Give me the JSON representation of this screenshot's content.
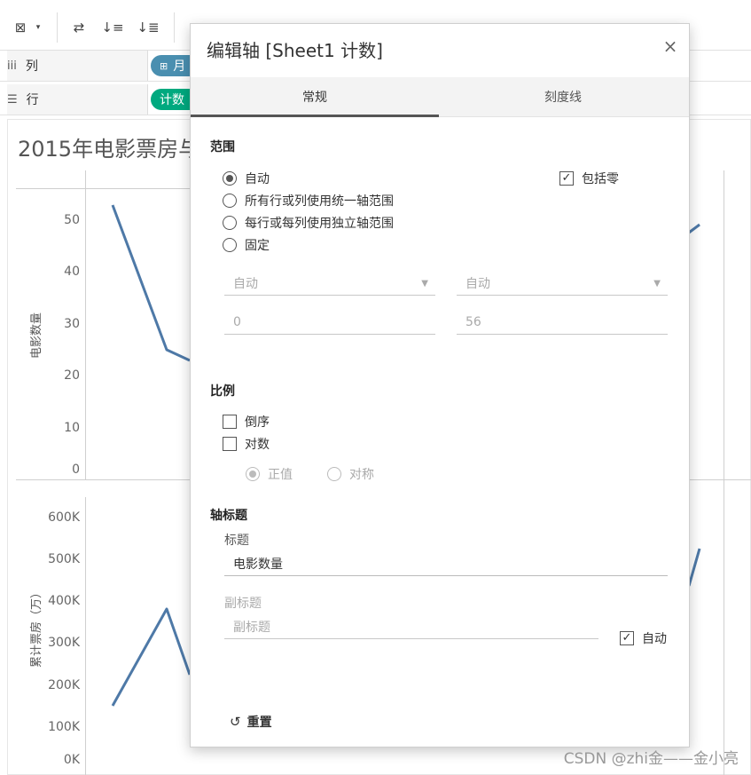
{
  "toolbar": {
    "icons": [
      "clear-sheet-icon",
      "dropdown-caret-icon",
      "swap-rows-columns-icon",
      "sort-ascending-icon",
      "sort-descending-icon"
    ]
  },
  "shelves": {
    "columns": {
      "icon": "iii",
      "label": "列",
      "pill": "月"
    },
    "rows": {
      "icon": "☰",
      "label": "行",
      "pill": "计数"
    }
  },
  "viz": {
    "title": "2015年电影票房与",
    "top_axis_label": "电影数量",
    "top_ticks": [
      "50",
      "40",
      "30",
      "20",
      "10",
      "0"
    ],
    "bottom_axis_label": "累计票房（万）",
    "bottom_ticks": [
      "600K",
      "500K",
      "400K",
      "300K",
      "200K",
      "100K",
      "0K"
    ],
    "line_color": "#4e79a7"
  },
  "dialog": {
    "title": "编辑轴 [Sheet1 计数]",
    "close": "×",
    "tabs": {
      "general": "常规",
      "ticks": "刻度线"
    },
    "range": {
      "heading": "范围",
      "options": [
        "自动",
        "所有行或列使用统一轴范围",
        "每行或每列使用独立轴范围",
        "固定"
      ],
      "selected": "自动",
      "include_zero": {
        "label": "包括零",
        "checked": true
      },
      "start_mode": "自动",
      "end_mode": "自动",
      "start_value": "0",
      "end_value": "56"
    },
    "scale": {
      "heading": "比例",
      "reversed": {
        "label": "倒序",
        "checked": false
      },
      "log": {
        "label": "对数",
        "checked": false
      },
      "positive": "正值",
      "symmetric": "对称"
    },
    "axis_title": {
      "heading": "轴标题",
      "title_label": "标题",
      "title_value": "电影数量",
      "subtitle_label": "副标题",
      "subtitle_placeholder": "副标题",
      "auto": {
        "label": "自动",
        "checked": true
      }
    },
    "reset": "重置"
  },
  "watermark": "CSDN @zhi金——金小亮"
}
